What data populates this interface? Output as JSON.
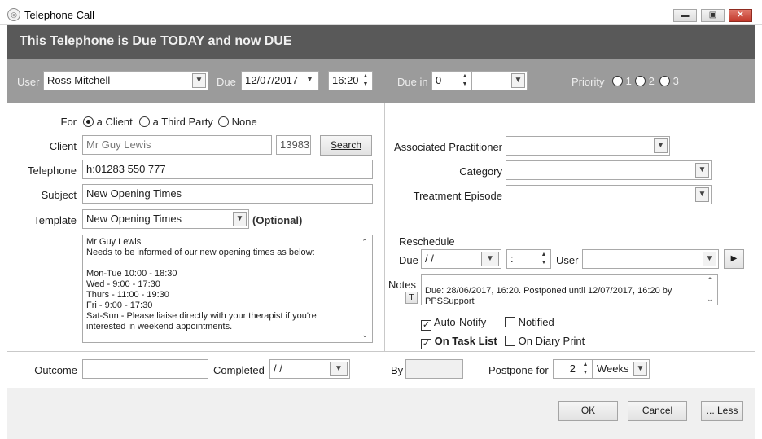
{
  "window": {
    "title": "Telephone Call",
    "minimize_icon": "minimize-icon",
    "restore_icon": "restore-icon",
    "close_icon": "close-icon"
  },
  "banner": {
    "text": "This Telephone is Due TODAY and now DUE",
    "color": "#595959"
  },
  "header": {
    "user_label": "User",
    "user_value": "Ross Mitchell",
    "due_label": "Due",
    "due_date": "12/07/2017",
    "due_time": "16:20",
    "due_in_label": "Due in",
    "due_in_value": "0",
    "priority_label": "Priority",
    "priority_options": [
      "1",
      "2",
      "3"
    ]
  },
  "left": {
    "for_label": "For",
    "for_options": [
      "a Client",
      "a Third Party",
      "None"
    ],
    "for_selected": "a Client",
    "client_label": "Client",
    "client_name": "Mr Guy Lewis",
    "client_id": "13983",
    "search_label": "Search",
    "telephone_label": "Telephone",
    "telephone_value": "h:01283 550 777",
    "subject_label": "Subject",
    "subject_value": "New Opening Times",
    "template_label": "Template",
    "template_value": "New Opening Times",
    "template_optional": "(Optional)",
    "memo": "Mr Guy Lewis\nNeeds to be informed of our new opening times as below:\n\nMon-Tue 10:00 - 18:30\nWed - 9:00 - 17:30\nThurs - 11:00 - 19:30\nFri - 9:00 - 17:30\nSat-Sun - Please liaise directly with your therapist if you're\ninterested in weekend appointments."
  },
  "right": {
    "practitioner_label": "Associated Practitioner",
    "practitioner_value": "",
    "category_label": "Category",
    "category_value": "",
    "episode_label": "Treatment Episode",
    "episode_value": "",
    "reschedule_label": "Reschedule",
    "due_label": "Due",
    "due_value": " /  /",
    "time_value": " :",
    "user_label": "User",
    "user_value": "",
    "notes_label": "Notes",
    "notes_button": "T",
    "notes_text": "Due: 28/06/2017, 16:20. Postponed until 12/07/2017, 16:20 by\nPPSSupport",
    "auto_notify_label": "Auto-Notify",
    "auto_notify_checked": true,
    "notified_label": "Notified",
    "notified_checked": false,
    "task_list_label": "On Task List",
    "task_list_checked": true,
    "diary_print_label": "On Diary Print",
    "diary_print_checked": false
  },
  "footer": {
    "outcome_label": "Outcome",
    "outcome_value": "",
    "completed_label": "Completed",
    "completed_value": " /  /",
    "by_label": "By",
    "by_value": "",
    "postpone_label": "Postpone for",
    "postpone_value": "2",
    "postpone_unit": "Weeks"
  },
  "buttons": {
    "ok": "OK",
    "cancel": "Cancel",
    "less": "... Less"
  }
}
